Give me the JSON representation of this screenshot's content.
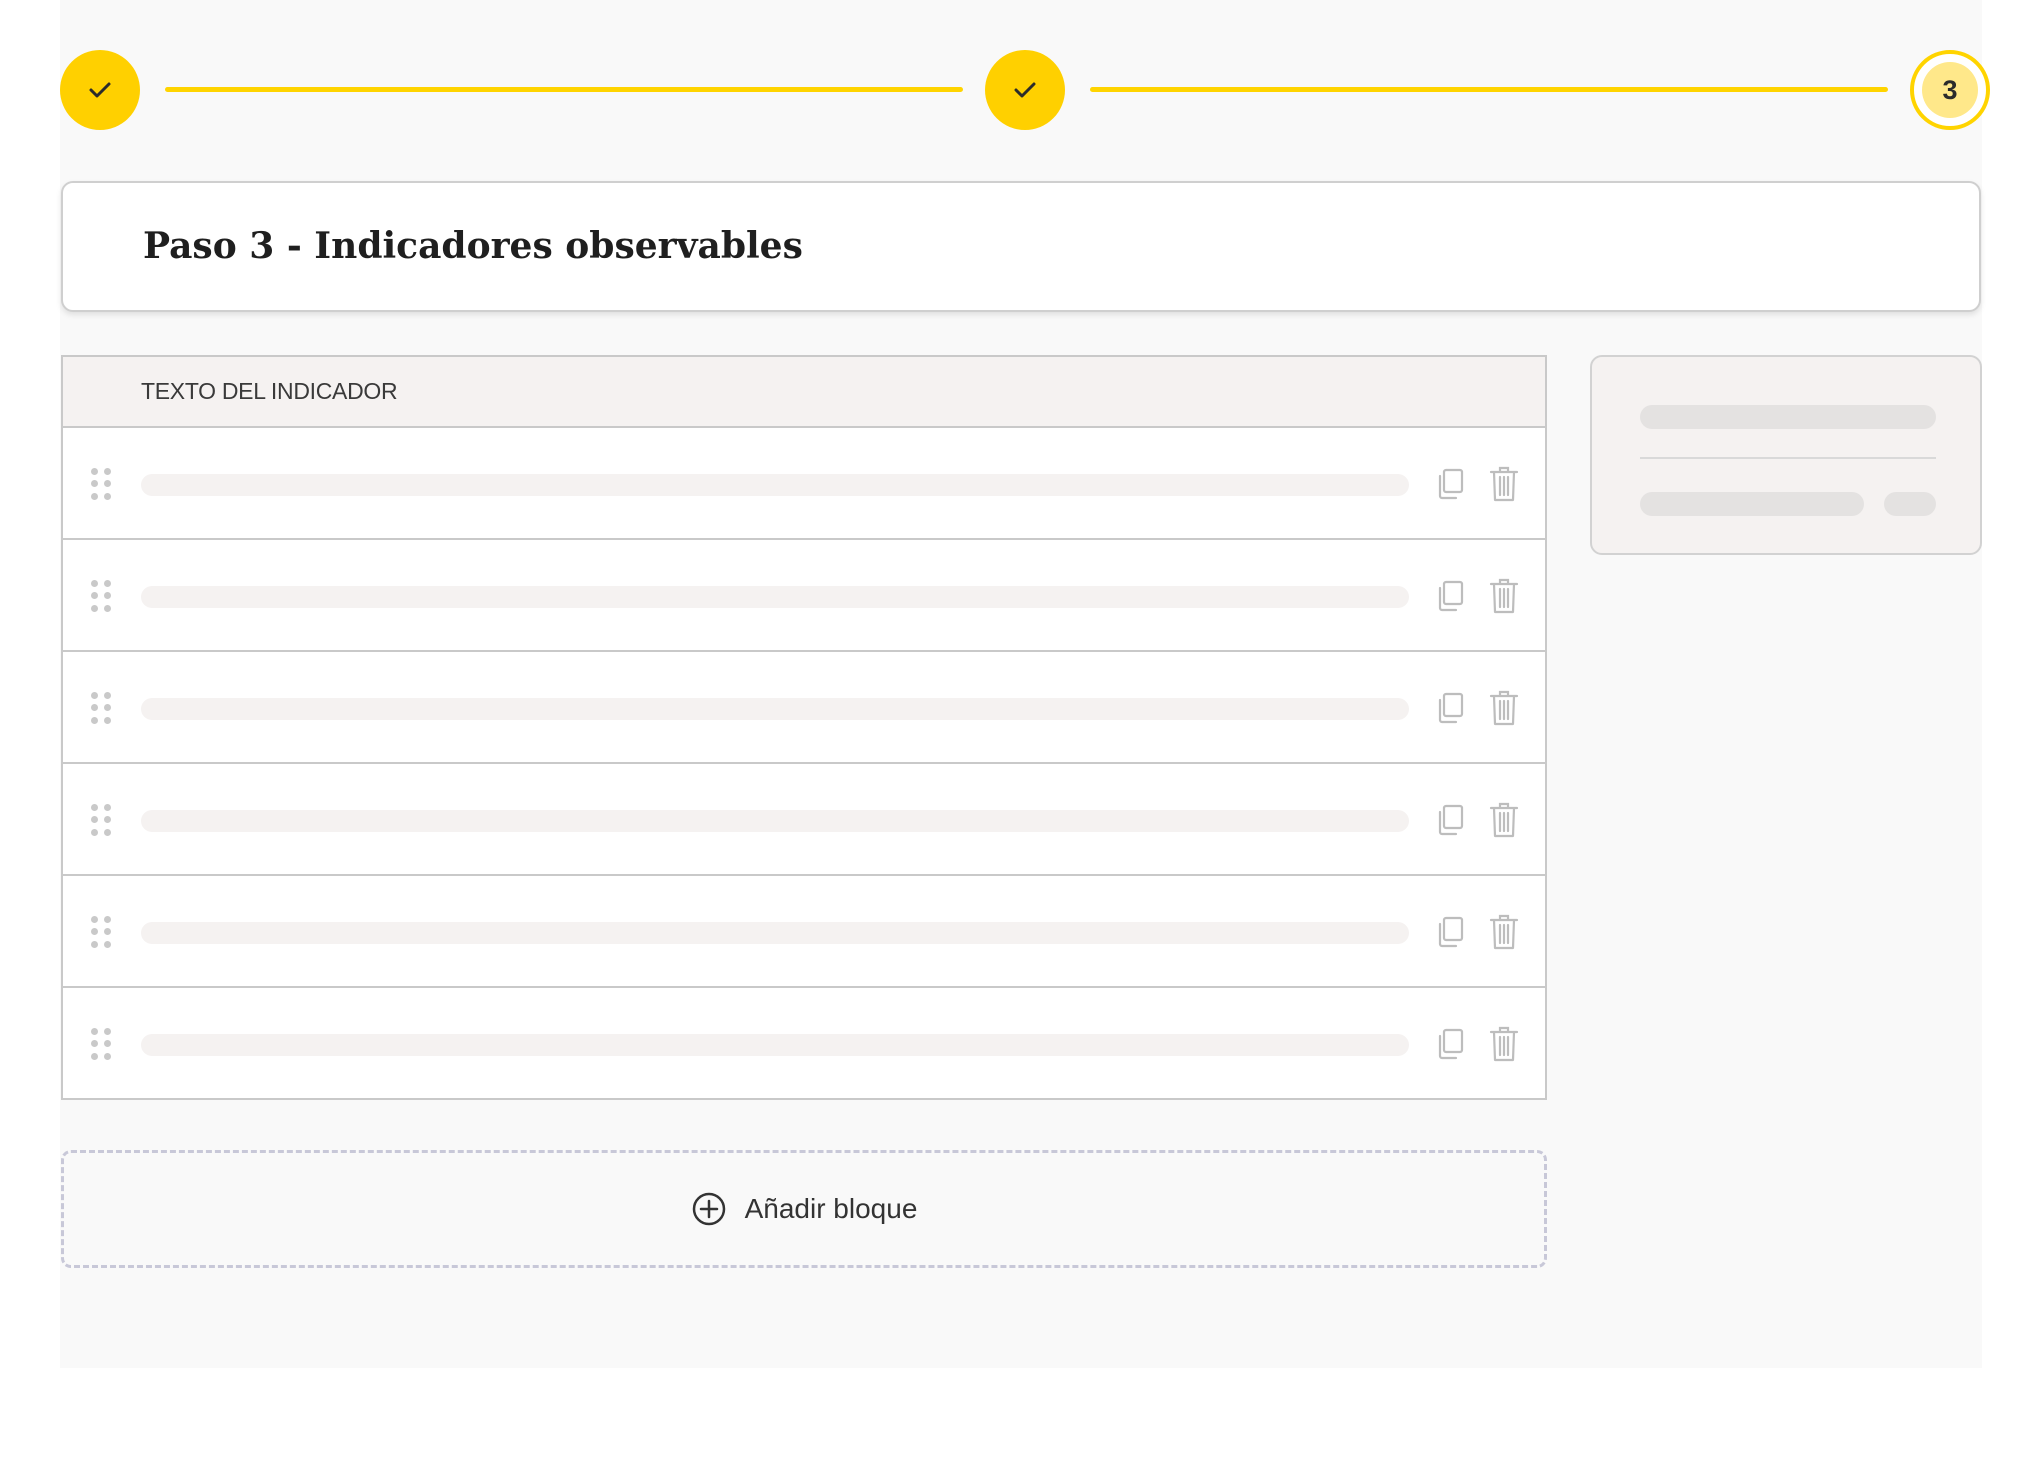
{
  "stepper": {
    "steps": [
      {
        "state": "done",
        "icon": "check-icon"
      },
      {
        "state": "done",
        "icon": "check-icon"
      },
      {
        "state": "current",
        "number": "3"
      }
    ],
    "accent_color": "#ffd000"
  },
  "title": "Paso 3 - Indicadores observables",
  "table": {
    "header": "TEXTO DEL INDICADOR",
    "row_count": 6,
    "row_icons": [
      "drag-handle-icon",
      "copy-icon",
      "trash-icon"
    ]
  },
  "add_block": {
    "label": "Añadir bloque",
    "icon": "plus-circle-icon"
  }
}
